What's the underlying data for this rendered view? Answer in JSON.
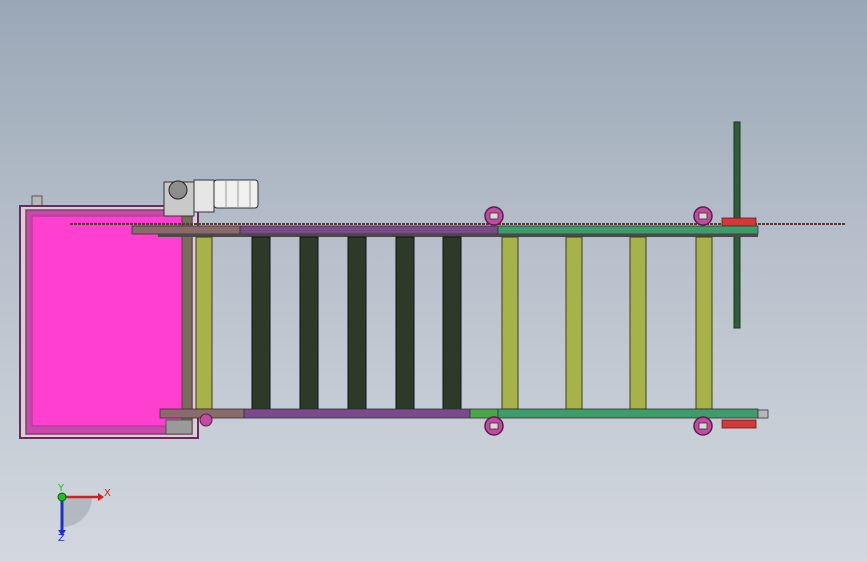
{
  "viewport": {
    "name": "cad-graphics-area",
    "background_top": "#9aa7b6",
    "background_bottom": "#d3d8df"
  },
  "model": {
    "description_items": [
      "hopper",
      "motor",
      "rollers",
      "side-rails",
      "wheels",
      "vertical-bar"
    ],
    "colors": {
      "hopper_fill": "#ff3fd0",
      "hopper_frame": "#8a3a74",
      "frame_green": "#3f9b6a",
      "frame_purple": "#7a4a8a",
      "roller_yellow": "#a8b24a",
      "roller_dark": "#2d3a2a",
      "wheel": "#c24aa0",
      "bar": "#2f5c3a",
      "accent_red": "#d23a3a"
    }
  },
  "triad": {
    "x_label": "X",
    "y_label": "Y",
    "z_label": "Z",
    "x_color": "#d22020",
    "y_color": "#20c020",
    "z_color": "#2030c0"
  }
}
